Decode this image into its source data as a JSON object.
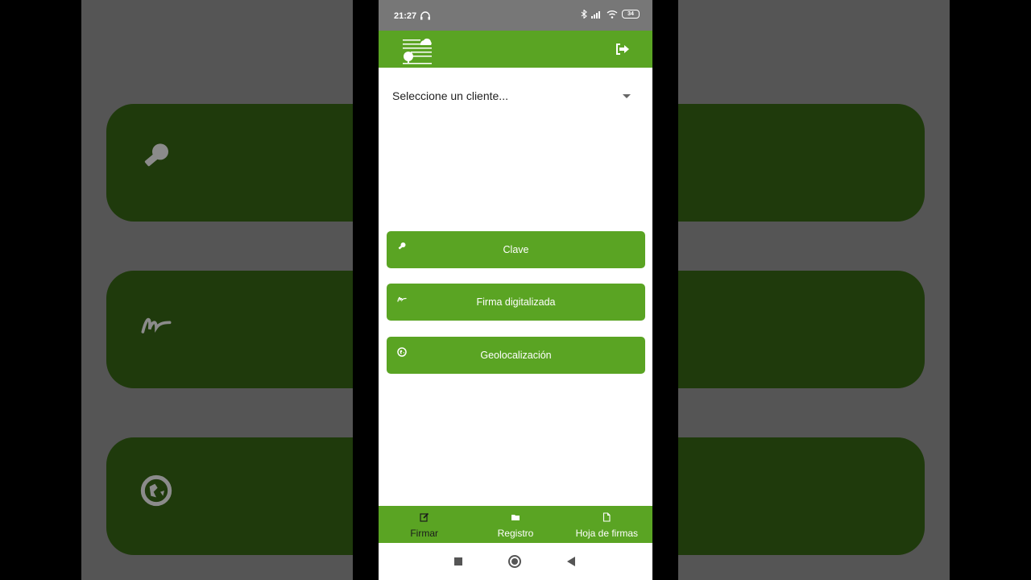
{
  "status": {
    "time": "21:27",
    "battery": "34"
  },
  "client_select": {
    "placeholder": "Seleccione un cliente..."
  },
  "buttons": [
    {
      "label": "Clave",
      "icon": "key-icon"
    },
    {
      "label": "Firma digitalizada",
      "icon": "signature-icon"
    },
    {
      "label": "Geolocalización",
      "icon": "globe-icon"
    }
  ],
  "bottom_nav": [
    {
      "label": "Firmar",
      "icon": "edit-icon",
      "active": true
    },
    {
      "label": "Registro",
      "icon": "folder-icon",
      "active": false
    },
    {
      "label": "Hoja de firmas",
      "icon": "file-icon",
      "active": false
    }
  ],
  "colors": {
    "primary": "#5aa423",
    "dark_bg_card": "#1f3a0c"
  }
}
